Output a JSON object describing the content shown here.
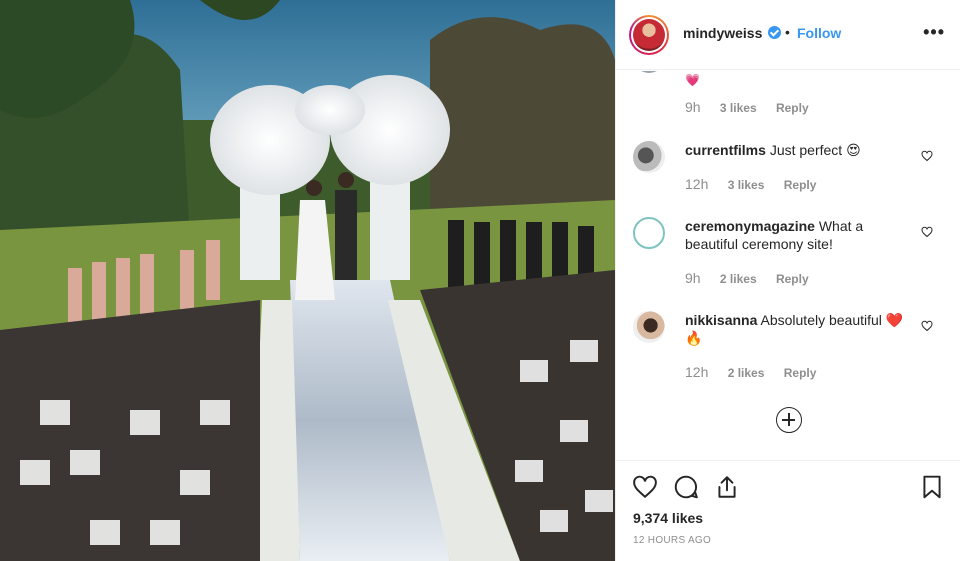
{
  "post": {
    "author": "mindyweiss",
    "separator": "•",
    "follow_label": "Follow",
    "more_label": "•••"
  },
  "comments": [
    {
      "user": "",
      "text": "💗",
      "time": "9h",
      "likes": "3 likes",
      "reply": "Reply",
      "has_heart": false
    },
    {
      "user": "currentfilms",
      "text": "Just perfect 😍",
      "time": "12h",
      "likes": "3 likes",
      "reply": "Reply",
      "has_heart": true
    },
    {
      "user": "ceremonymagazine",
      "text": "What a beautiful ceremony site!",
      "time": "9h",
      "likes": "2 likes",
      "reply": "Reply",
      "has_heart": true
    },
    {
      "user": "nikkisanna",
      "text": "Absolutely beautiful ❤️🔥",
      "time": "12h",
      "likes": "2 likes",
      "reply": "Reply",
      "has_heart": true
    }
  ],
  "footer": {
    "likes": "9,374 likes",
    "posted": "12 HOURS AGO"
  },
  "icons": {
    "like": "heart-icon",
    "comment": "comment-icon",
    "share": "share-icon",
    "save": "bookmark-icon",
    "load_more": "plus-circle-icon"
  },
  "colors": {
    "accent": "#3897f0",
    "text": "#262626",
    "muted": "#8e8e8e",
    "border": "#efefef"
  }
}
